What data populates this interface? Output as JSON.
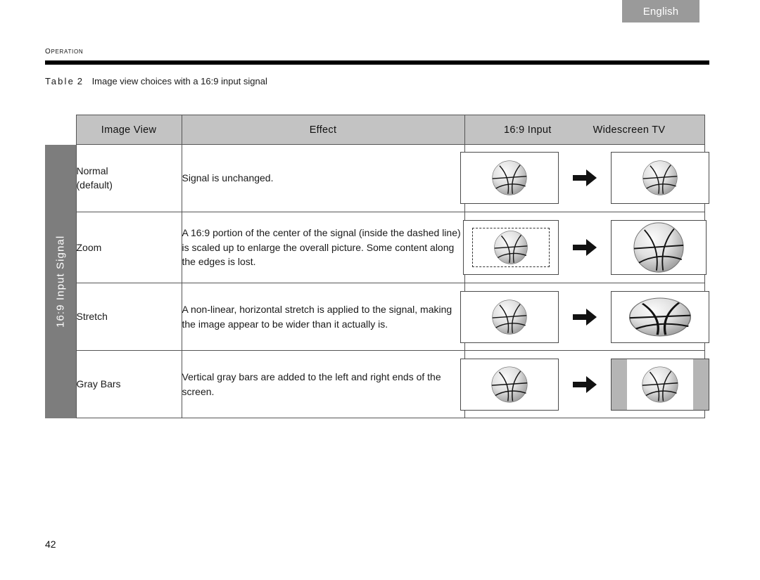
{
  "language_tab": {
    "label": "English"
  },
  "running_head": {
    "section": "Operation"
  },
  "caption": {
    "label": "Table",
    "number": "2",
    "text": "Image view choices with a 16:9 input signal"
  },
  "side_tab": {
    "label": "16:9 Input Signal"
  },
  "table": {
    "headers": {
      "image_view": "Image View",
      "effect": "Effect",
      "input": "16:9 Input",
      "output": "Widescreen TV"
    },
    "rows": [
      {
        "view": "Normal",
        "view_sub": "(default)",
        "effect": "Signal is unchanged.",
        "illustration": "normal",
        "arrow": "right-arrow-icon"
      },
      {
        "view": "Zoom",
        "view_sub": "",
        "effect": "A 16:9 portion of the center of the signal (inside the dashed line) is scaled up to enlarge the overall picture. Some content along the edges is lost.",
        "illustration": "zoom",
        "arrow": "right-arrow-icon"
      },
      {
        "view": "Stretch",
        "view_sub": "",
        "effect": "A non-linear, horizontal stretch is applied to the signal, making the image appear to be wider than it actually is.",
        "illustration": "stretch",
        "arrow": "right-arrow-icon"
      },
      {
        "view": "Gray Bars",
        "view_sub": "",
        "effect": "Vertical gray bars are added to the left and right ends of the screen.",
        "illustration": "graybars",
        "arrow": "right-arrow-icon"
      }
    ]
  },
  "footer": {
    "page_number": "42"
  },
  "colors": {
    "tab_gray": "#9a9a9a",
    "header_gray": "#c3c3c3",
    "side_tab_gray": "#7d7d7d",
    "gray_bar": "#b5b5b5",
    "rule_black": "#000000"
  }
}
